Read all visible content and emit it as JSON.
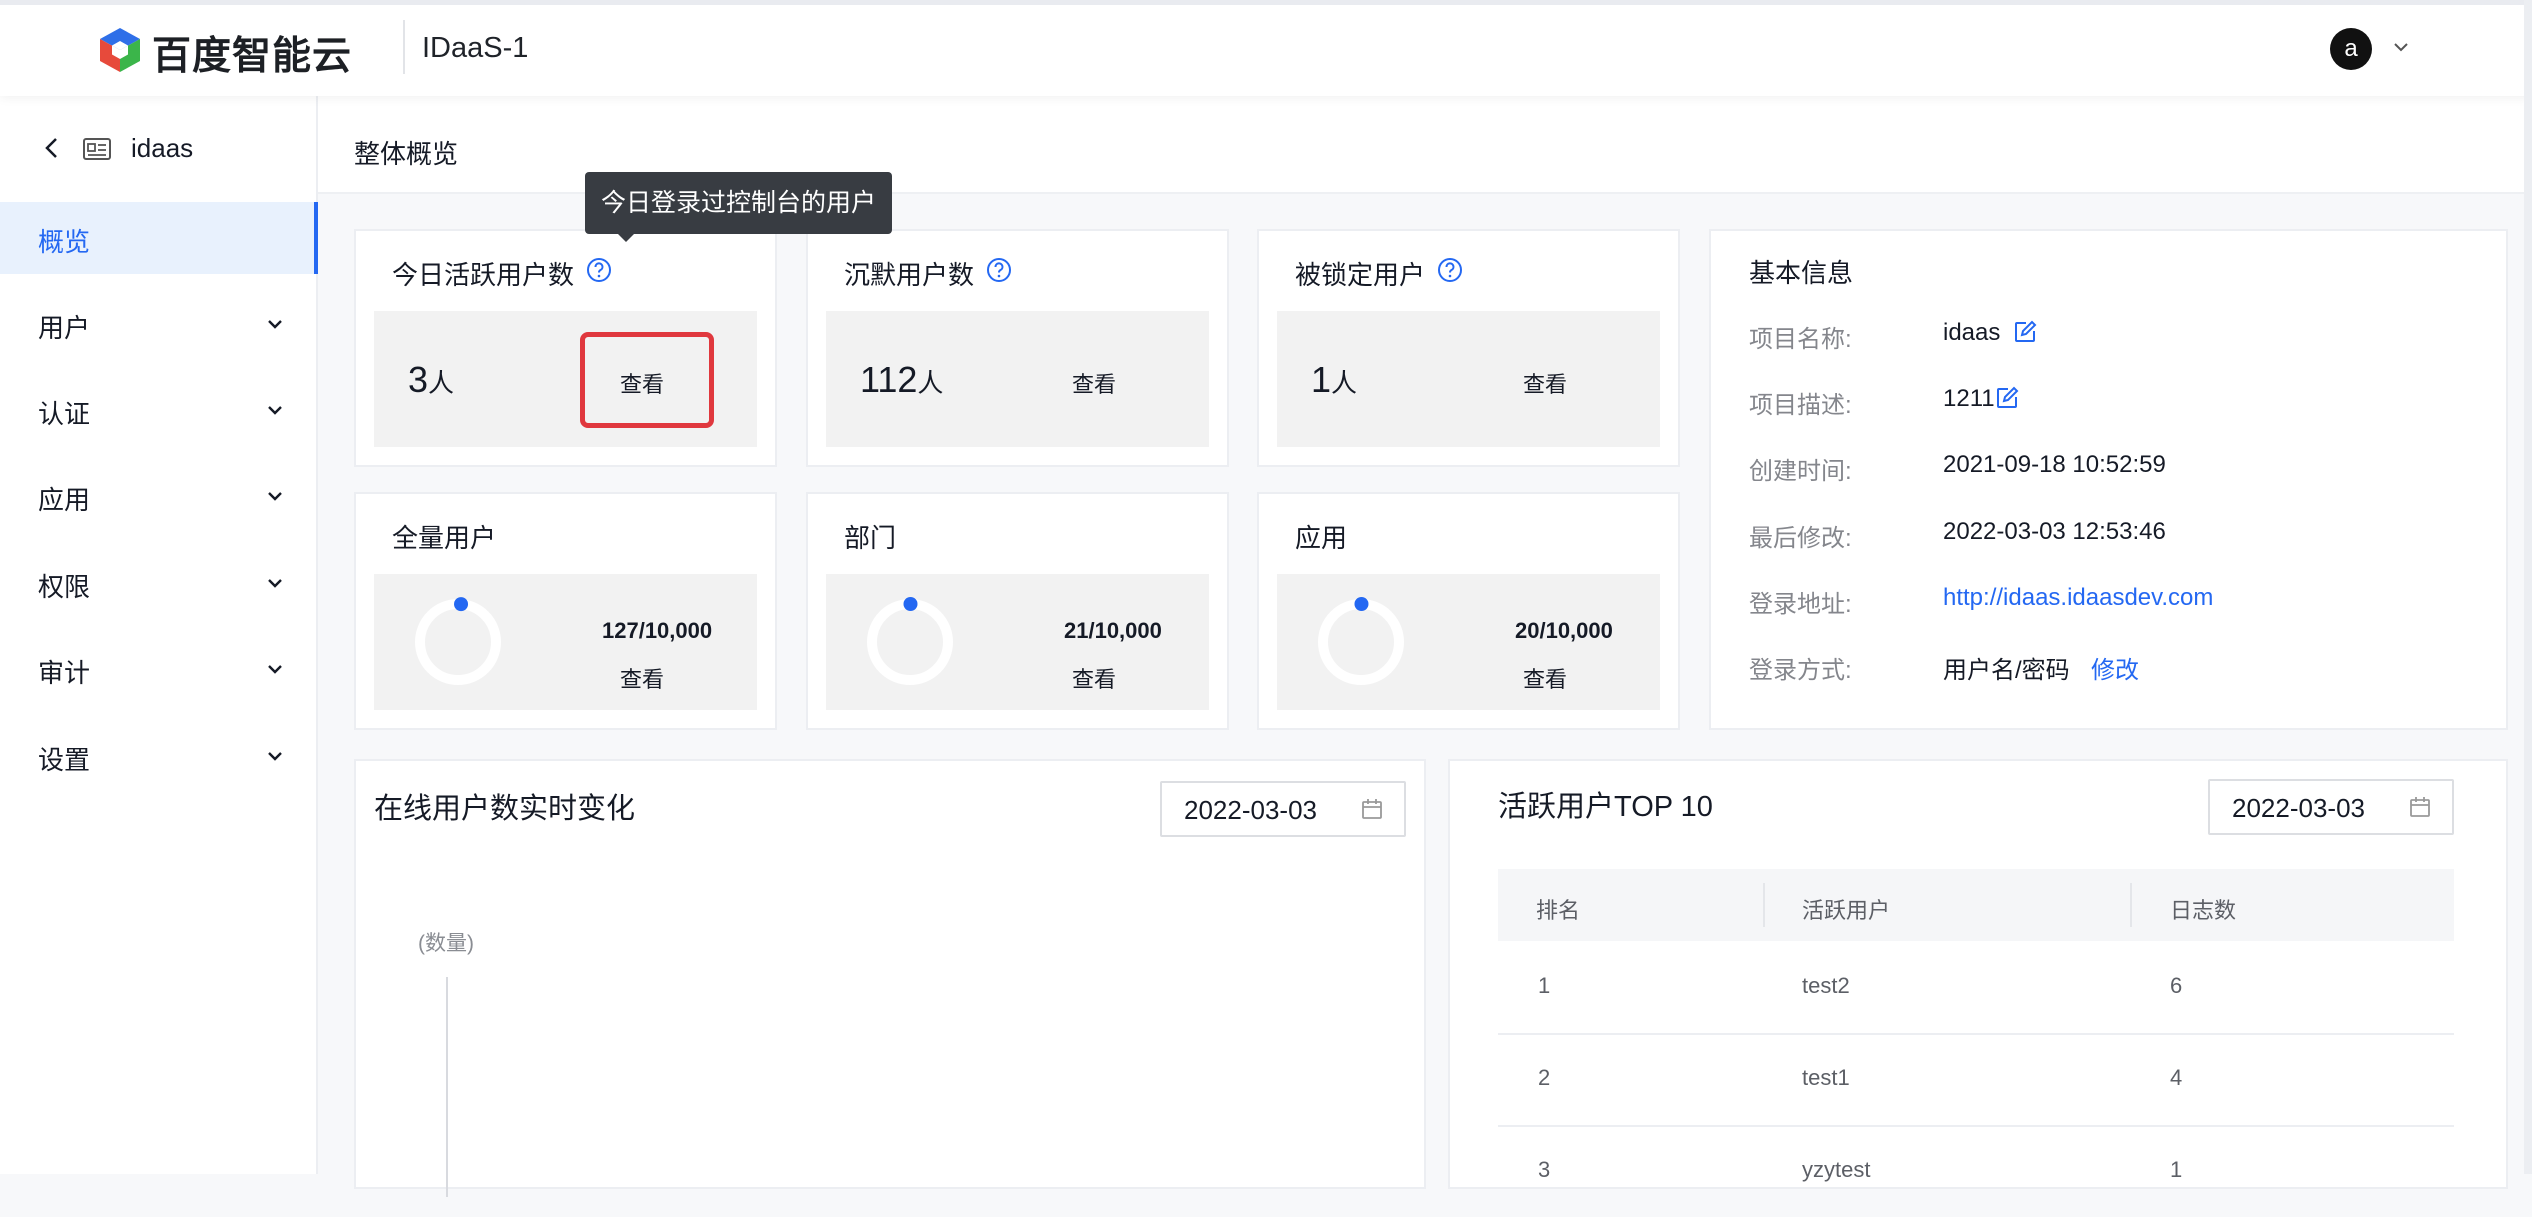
{
  "header": {
    "brand": "百度智能云",
    "project": "IDaaS-1",
    "avatar_letter": "a"
  },
  "sidebar": {
    "project": "idaas",
    "items": [
      {
        "label": "概览",
        "active": true
      },
      {
        "label": "用户"
      },
      {
        "label": "认证"
      },
      {
        "label": "应用"
      },
      {
        "label": "权限"
      },
      {
        "label": "审计"
      },
      {
        "label": "设置"
      }
    ]
  },
  "page": {
    "title": "整体概览"
  },
  "tooltip": {
    "text": "今日登录过控制台的用户"
  },
  "stats": [
    {
      "title": "今日活跃用户数",
      "value": "3",
      "unit": "人",
      "action": "查看"
    },
    {
      "title": "沉默用户数",
      "value": "112",
      "unit": "人",
      "action": "查看"
    },
    {
      "title": "被锁定用户",
      "value": "1",
      "unit": "人",
      "action": "查看"
    }
  ],
  "quotas": [
    {
      "title": "全量用户",
      "value": "127/10,000",
      "action": "查看",
      "used": 127,
      "total": 10000
    },
    {
      "title": "部门",
      "value": "21/10,000",
      "action": "查看",
      "used": 21,
      "total": 10000
    },
    {
      "title": "应用",
      "value": "20/10,000",
      "action": "查看",
      "used": 20,
      "total": 10000
    }
  ],
  "basic_info": {
    "title": "基本信息",
    "rows": [
      {
        "label": "项目名称:",
        "value": "idaas"
      },
      {
        "label": "项目描述:",
        "value": "1211"
      },
      {
        "label": "创建时间:",
        "value": "2021-09-18 10:52:59"
      },
      {
        "label": "最后修改:",
        "value": "2022-03-03 12:53:46"
      },
      {
        "label": "登录地址:",
        "value": "http://idaas.idaasdev.com"
      },
      {
        "label": "登录方式:",
        "value": "用户名/密码",
        "action": "修改"
      }
    ]
  },
  "online_chart": {
    "title": "在线用户数实时变化",
    "date": "2022-03-03",
    "y_label": "(数量)"
  },
  "top10": {
    "title": "活跃用户TOP 10",
    "date": "2022-03-03",
    "columns": [
      "排名",
      "活跃用户",
      "日志数"
    ],
    "rows": [
      [
        "1",
        "test2",
        "6"
      ],
      [
        "2",
        "test1",
        "4"
      ],
      [
        "3",
        "yzytest",
        "1"
      ]
    ]
  },
  "colors": {
    "accent": "#2468f2",
    "highlight": "#e0383e",
    "tooltip_bg": "#383c42"
  }
}
